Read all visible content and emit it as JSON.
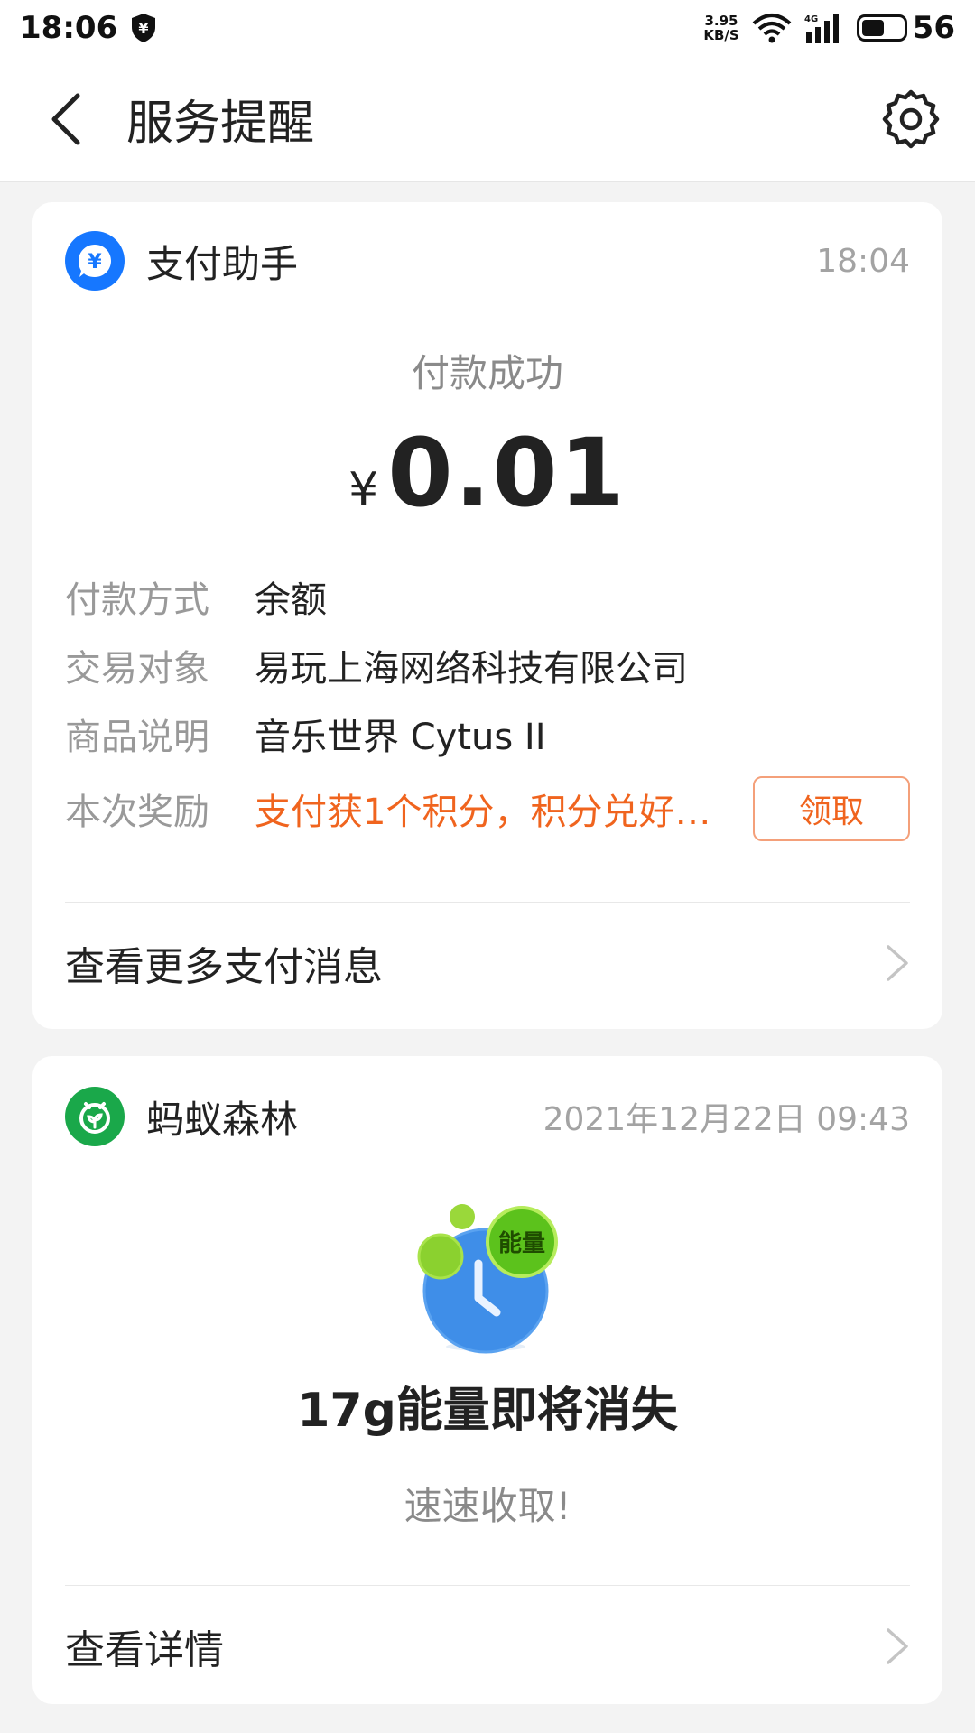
{
  "status_bar": {
    "time": "18:06",
    "speed_value": "3.95",
    "speed_unit": "KB/S",
    "network": "4G",
    "battery": "56"
  },
  "header": {
    "title": "服务提醒",
    "back_icon": "chevron-left-icon",
    "settings_icon": "gear-icon"
  },
  "payment_card": {
    "app_name": "支付助手",
    "time": "18:04",
    "status": "付款成功",
    "currency": "¥",
    "amount": "0.01",
    "details": [
      {
        "label": "付款方式",
        "value": "余额"
      },
      {
        "label": "交易对象",
        "value": "易玩上海网络科技有限公司"
      },
      {
        "label": "商品说明",
        "value": "音乐世界 Cytus II"
      },
      {
        "label": "本次奖励",
        "value": "支付获1个积分，积分兑好…"
      }
    ],
    "claim_button": "领取",
    "more_link": "查看更多支付消息",
    "accent_color": "#f0641e",
    "icon_color": "#1677ff"
  },
  "forest_card": {
    "app_name": "蚂蚁森林",
    "time": "2021年12月22日 09:43",
    "badge_text": "能量",
    "title": "17g能量即将消失",
    "subtitle": "速速收取!",
    "more_link": "查看详情",
    "icon_color": "#1aa84a"
  }
}
